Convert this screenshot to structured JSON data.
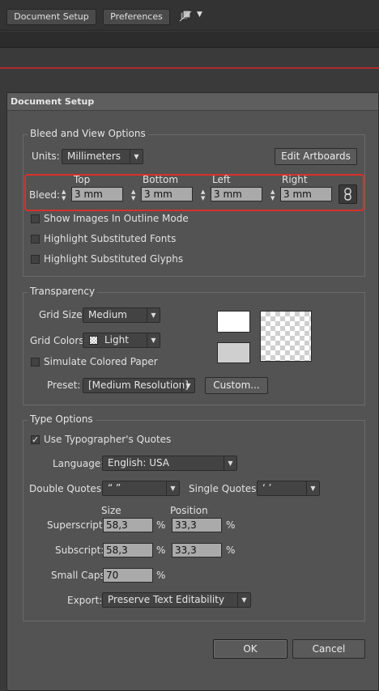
{
  "toolbar": {
    "document_setup_label": "Document Setup",
    "preferences_label": "Preferences",
    "arrange_icon": "arrange-documents-icon",
    "menu_arrow": "▼"
  },
  "dialog": {
    "title": "Document Setup",
    "ok_label": "OK",
    "cancel_label": "Cancel"
  },
  "bleed_view": {
    "legend": "Bleed and View Options",
    "units_label": "Units:",
    "units_value": "Millimeters",
    "edit_artboards_label": "Edit Artboards",
    "bleed_label": "Bleed:",
    "top_label": "Top",
    "bottom_label": "Bottom",
    "left_label": "Left",
    "right_label": "Right",
    "top_value": "3 mm",
    "bottom_value": "3 mm",
    "left_value": "3 mm",
    "right_value": "3 mm",
    "link_icon": "chain-link-icon",
    "highlight_color": "#d9302c",
    "show_images_outline": {
      "label": "Show Images In Outline Mode",
      "checked": false
    },
    "highlight_fonts": {
      "label": "Highlight Substituted Fonts",
      "checked": false
    },
    "highlight_glyphs": {
      "label": "Highlight Substituted Glyphs",
      "checked": false
    }
  },
  "transparency": {
    "legend": "Transparency",
    "grid_size_label": "Grid Size:",
    "grid_size_value": "Medium",
    "grid_colors_label": "Grid Colors:",
    "grid_colors_value": "Light",
    "simulate_paper": {
      "label": "Simulate Colored Paper",
      "checked": false
    },
    "preset_label": "Preset:",
    "preset_value": "[Medium Resolution]",
    "custom_label": "Custom..."
  },
  "type_options": {
    "legend": "Type Options",
    "typographers_quotes": {
      "label": "Use Typographer's Quotes",
      "checked": true
    },
    "checkmark": "✓",
    "language_label": "Language:",
    "language_value": "English: USA",
    "double_quotes_label": "Double Quotes:",
    "double_quotes_value": "“ ”",
    "single_quotes_label": "Single Quotes:",
    "single_quotes_value": "‘ ’",
    "size_header": "Size",
    "position_header": "Position",
    "superscript_label": "Superscript:",
    "superscript_size": "58,3",
    "superscript_position": "33,3",
    "subscript_label": "Subscript:",
    "subscript_size": "58,3",
    "subscript_position": "33,3",
    "small_caps_label": "Small Caps:",
    "small_caps_value": "70",
    "percent": "%",
    "export_label": "Export:",
    "export_value": "Preserve Text Editability"
  }
}
